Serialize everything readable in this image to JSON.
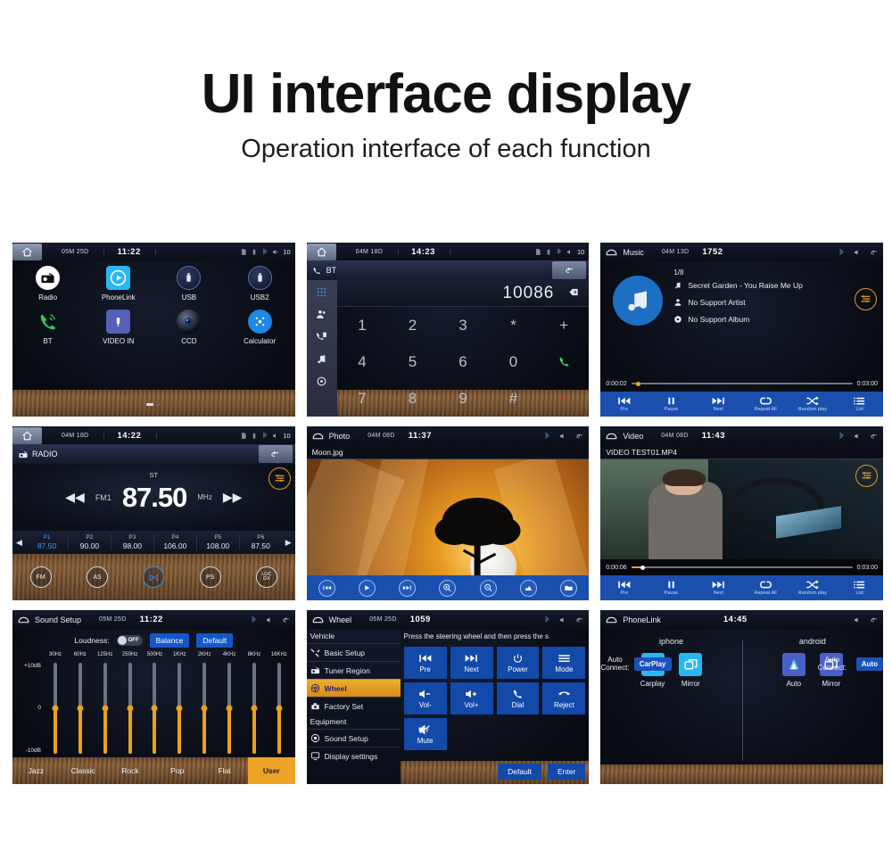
{
  "header": {
    "title": "UI interface display",
    "subtitle": "Operation interface of each function"
  },
  "panels": {
    "home": {
      "name": "Home",
      "status": {
        "date": "05M 25D",
        "time": "11:22",
        "volume": "10",
        "icons": [
          "sd-card-icon",
          "usb-icon",
          "bluetooth-icon",
          "volume-icon"
        ]
      },
      "apps": [
        {
          "label": "Radio",
          "icon": "radio-icon"
        },
        {
          "label": "PhoneLink",
          "icon": "phonelink-icon"
        },
        {
          "label": "USB",
          "icon": "usb-icon"
        },
        {
          "label": "USB2",
          "icon": "usb2-icon"
        },
        {
          "label": "BT",
          "icon": "bluetooth-phone-icon"
        },
        {
          "label": "VIDEO IN",
          "icon": "video-in-icon"
        },
        {
          "label": "CCD",
          "icon": "ccd-camera-icon"
        },
        {
          "label": "Calculator",
          "icon": "calculator-icon"
        }
      ]
    },
    "bt": {
      "name": "BT",
      "status": {
        "date": "04M 18D",
        "time": "14:23",
        "volume": "10"
      },
      "title": "BT",
      "number": "10086",
      "rail": [
        "keypad-icon",
        "contacts-icon",
        "call-log-icon",
        "bt-music-icon",
        "bt-settings-icon"
      ],
      "keys": [
        "1",
        "2",
        "3",
        "*",
        "+",
        "4",
        "5",
        "6",
        "0",
        "call",
        "7",
        "8",
        "9",
        "#",
        "hangup"
      ]
    },
    "music": {
      "name": "Music",
      "title": "Music",
      "status": {
        "date": "04M 13D",
        "time": "1752"
      },
      "track_count": "1/8",
      "track": "Secret Garden - You Raise Me Up",
      "artist": "No Support Artist",
      "album": "No Support Album",
      "elapsed": "0:00:02",
      "duration": "0:03:00",
      "progress_pct": 2,
      "controls": [
        {
          "label": "Pre",
          "icon": "previous-icon"
        },
        {
          "label": "Pause",
          "icon": "pause-icon"
        },
        {
          "label": "Next",
          "icon": "next-icon"
        },
        {
          "label": "Repeat All",
          "icon": "repeat-icon"
        },
        {
          "label": "Random play",
          "icon": "shuffle-icon"
        },
        {
          "label": "List",
          "icon": "list-icon"
        }
      ]
    },
    "radio": {
      "name": "RADIO",
      "status": {
        "date": "04M 18D",
        "time": "14:22",
        "volume": "10"
      },
      "title": "RADIO",
      "stereo": "ST",
      "band": "FM1",
      "frequency": "87.50",
      "unit": "MHz",
      "presets": [
        {
          "name": "P1",
          "value": "87.50",
          "active": true
        },
        {
          "name": "P2",
          "value": "90.00",
          "active": false
        },
        {
          "name": "P3",
          "value": "98.00",
          "active": false
        },
        {
          "name": "P4",
          "value": "106.00",
          "active": false
        },
        {
          "name": "P5",
          "value": "108.00",
          "active": false
        },
        {
          "name": "P6",
          "value": "87.50",
          "active": false
        }
      ],
      "buttons": [
        {
          "label": "FM",
          "active": false
        },
        {
          "label": "AS",
          "active": false
        },
        {
          "label": "SCAN",
          "active": true
        },
        {
          "label": "PS",
          "active": false
        },
        {
          "label": "LOC DX",
          "active": false
        }
      ]
    },
    "photo": {
      "name": "Photo",
      "title": "Photo",
      "status": {
        "date": "04M 08D",
        "time": "11:37"
      },
      "filename": "Moon.jpg",
      "controls": [
        "previous-icon",
        "play-icon",
        "next-icon",
        "zoom-in-icon",
        "zoom-out-icon",
        "rotate-icon",
        "folder-icon"
      ]
    },
    "video": {
      "name": "Video",
      "title": "Video",
      "status": {
        "date": "04M 08D",
        "time": "11:43"
      },
      "filename": "VIDEO TEST01.MP4",
      "elapsed": "0:00:06",
      "duration": "0:03:00",
      "progress_pct": 4,
      "controls": [
        {
          "label": "Pre",
          "icon": "previous-icon"
        },
        {
          "label": "Pause",
          "icon": "pause-icon"
        },
        {
          "label": "Next",
          "icon": "next-icon"
        },
        {
          "label": "Repeat All",
          "icon": "repeat-icon"
        },
        {
          "label": "Random play",
          "icon": "shuffle-icon"
        },
        {
          "label": "List",
          "icon": "list-icon"
        }
      ]
    },
    "sound": {
      "name": "Sound Setup",
      "title": "Sound Setup",
      "status": {
        "date": "05M 25D",
        "time": "11:22"
      },
      "loudness_label": "Loudness:",
      "loudness_state": "OFF",
      "balance_label": "Balance",
      "default_label": "Default",
      "scale": {
        "top": "+10dB",
        "mid": "0",
        "bottom": "-10dB"
      },
      "bands": [
        "30Hz",
        "60Hz",
        "125Hz",
        "250Hz",
        "500Hz",
        "1KHz",
        "2KHz",
        "4KHz",
        "8KHz",
        "16KHz"
      ],
      "values": [
        0,
        0,
        0,
        0,
        0,
        0,
        0,
        0,
        0,
        0
      ],
      "presets": [
        {
          "label": "Jazz",
          "active": false
        },
        {
          "label": "Classic",
          "active": false
        },
        {
          "label": "Rock",
          "active": false
        },
        {
          "label": "Pop",
          "active": false
        },
        {
          "label": "Flat",
          "active": false
        },
        {
          "label": "User",
          "active": true
        }
      ]
    },
    "wheel": {
      "name": "Wheel",
      "title": "Wheel",
      "status": {
        "date": "05M 25D",
        "time": "1059"
      },
      "tip": "Press the steering wheel and then press the s",
      "group_vehicle": "Vehicle",
      "group_equipment": "Equipment",
      "menu": [
        {
          "label": "Basic Setup",
          "icon": "tools-icon",
          "active": false
        },
        {
          "label": "Tuner Region",
          "icon": "radio-icon",
          "active": false
        },
        {
          "label": "Wheel",
          "icon": "steering-wheel-icon",
          "active": true
        },
        {
          "label": "Factory Set",
          "icon": "factory-icon",
          "active": false
        }
      ],
      "menu2": [
        {
          "label": "Sound Setup",
          "icon": "sound-icon",
          "active": false
        },
        {
          "label": "Display settings",
          "icon": "display-icon",
          "active": false
        }
      ],
      "keys": [
        {
          "label": "Pre",
          "icon": "previous-icon"
        },
        {
          "label": "Next",
          "icon": "next-icon"
        },
        {
          "label": "Power",
          "icon": "power-icon"
        },
        {
          "label": "Mode",
          "icon": "mode-icon"
        },
        {
          "label": "Vol-",
          "icon": "volume-down-icon"
        },
        {
          "label": "Vol+",
          "icon": "volume-up-icon"
        },
        {
          "label": "Dial",
          "icon": "dial-icon"
        },
        {
          "label": "Reject",
          "icon": "reject-icon"
        },
        {
          "label": "Mute",
          "icon": "mute-icon"
        }
      ],
      "default_label": "Default",
      "enter_label": "Enter"
    },
    "phonelink": {
      "name": "PhoneLink",
      "title": "PhoneLink",
      "status": {
        "time": "14:45"
      },
      "iphone": {
        "title": "iphone",
        "apps": [
          {
            "label": "Carplay",
            "icon": "carplay-icon"
          },
          {
            "label": "Mirror",
            "icon": "mirror-icon"
          }
        ],
        "auto_connect_label": "Auto Connect:",
        "auto_connect_value": "CarPlay"
      },
      "android": {
        "title": "android",
        "apps": [
          {
            "label": "Auto",
            "icon": "android-auto-icon"
          },
          {
            "label": "Mirror",
            "icon": "mirror-icon"
          }
        ],
        "auto_connect_label": "Auto Connect:",
        "auto_connect_value": "Auto"
      }
    }
  },
  "colors": {
    "accent_blue": "#1a4fad",
    "accent_orange": "#e8a21c",
    "bg": "#07080e"
  }
}
